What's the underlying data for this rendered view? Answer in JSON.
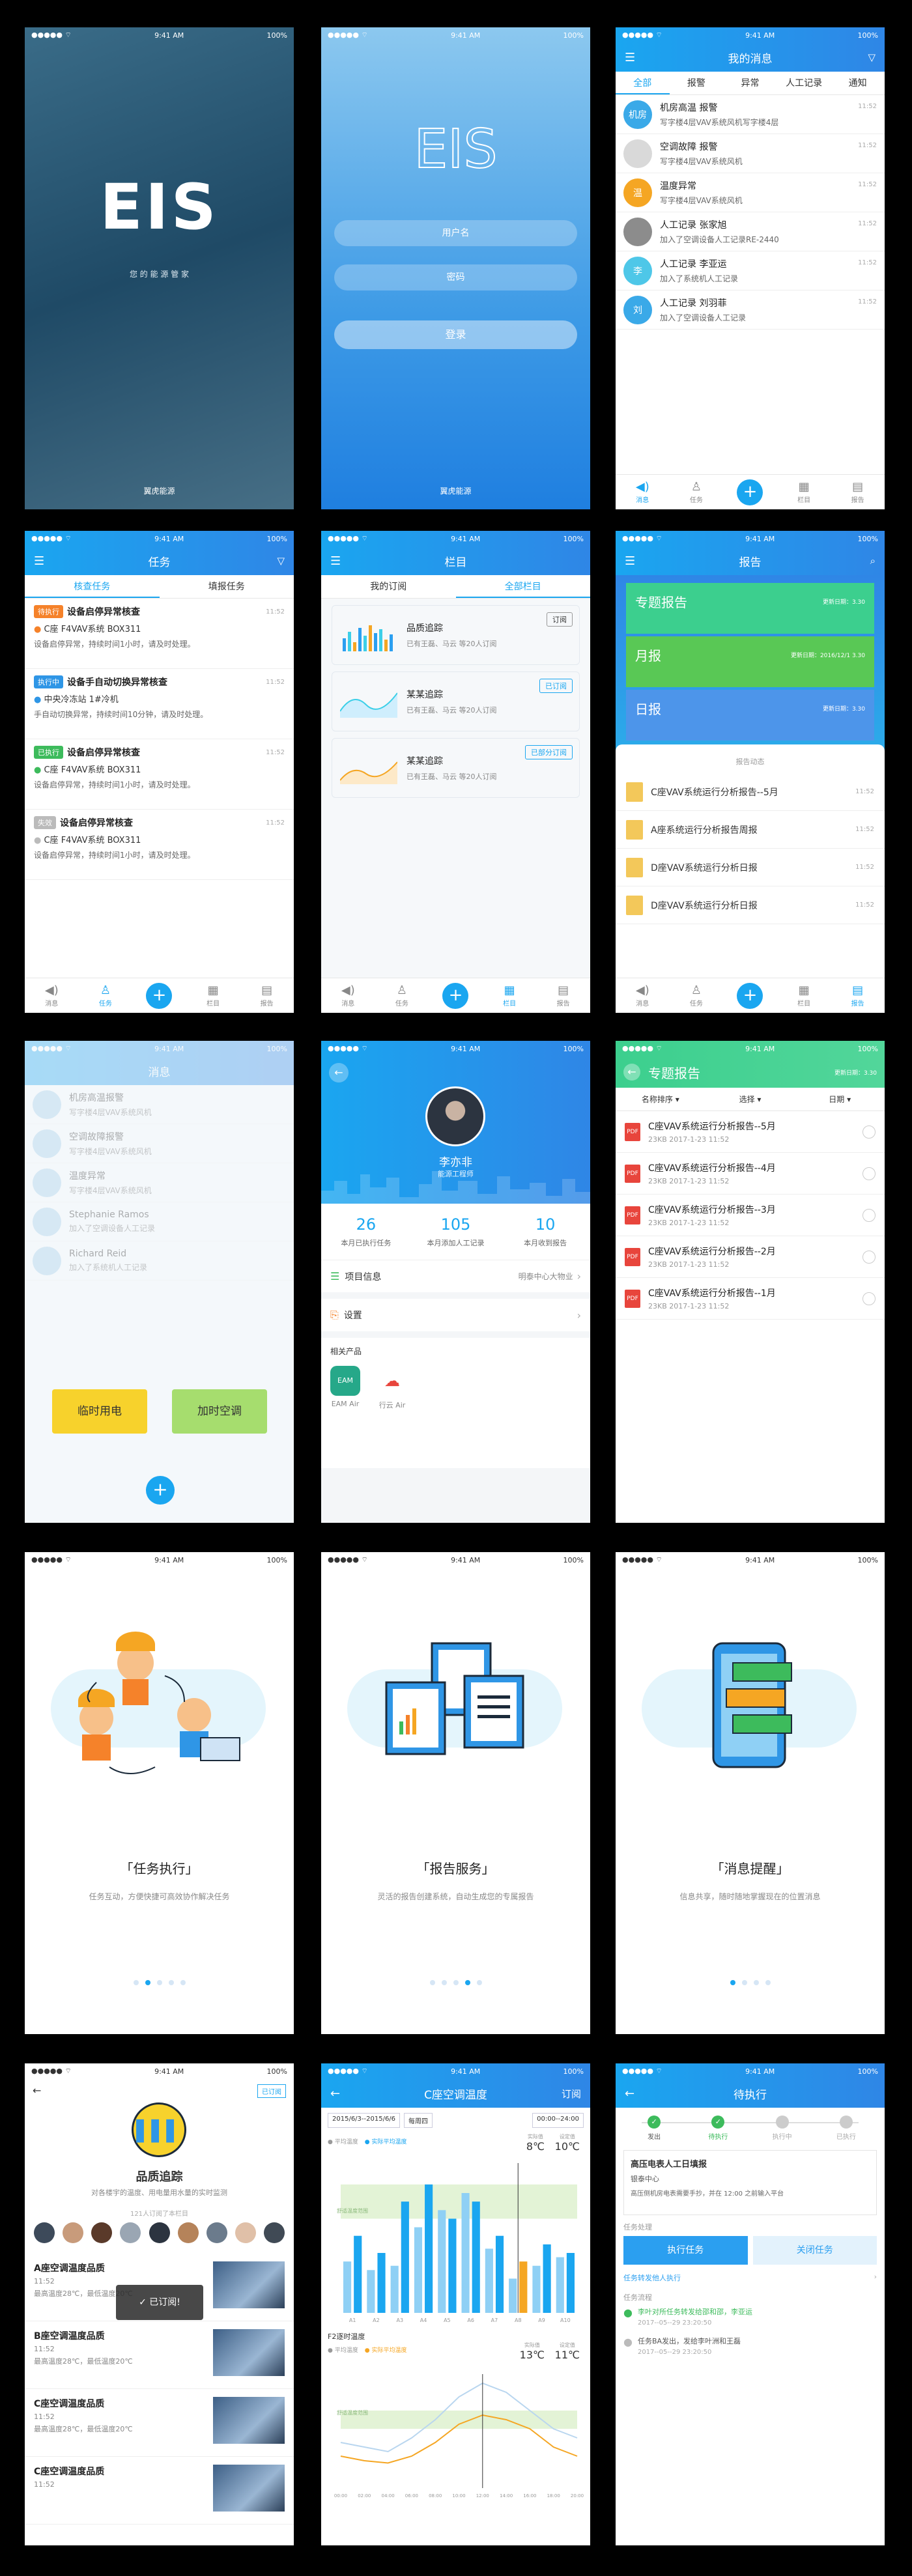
{
  "status": {
    "carrier": "●●●●● ⌔",
    "time": "9:41 AM",
    "battery": "100%"
  },
  "login": {
    "logo": "EIS",
    "slogan": "您 的 能 源 管 家",
    "footer": "翼虎能源",
    "user_ph": "用户名",
    "pass_ph": "密码",
    "button": "登录"
  },
  "messages": {
    "title": "我的消息",
    "tabs": [
      "全部",
      "报警",
      "异常",
      "人工记录",
      "通知"
    ],
    "items": [
      {
        "avatar": "机房",
        "color": "#3aa9e8",
        "title": "机房高温 报警",
        "sub": "写字楼4层VAV系统风机写字楼4层",
        "time": "11:52"
      },
      {
        "avatar": "",
        "color": "#d9d9d9",
        "title": "空调故障 报警",
        "sub": "写字楼4层VAV系统风机",
        "time": "11:52"
      },
      {
        "avatar": "温",
        "color": "#f5a623",
        "title": "温度异常",
        "sub": "写字楼4层VAV系统风机",
        "time": "11:52"
      },
      {
        "avatar": "",
        "color": "#8c8c8c",
        "title": "人工记录 张家旭",
        "sub": "加入了空调设备人工记录RE-2440",
        "time": "11:52"
      },
      {
        "avatar": "李",
        "color": "#4ec7e8",
        "title": "人工记录 李亚运",
        "sub": "加入了系统机人工记录",
        "time": "11:52"
      },
      {
        "avatar": "刘",
        "color": "#3aa9e8",
        "title": "人工记录 刘羽菲",
        "sub": "加入了空调设备人工记录",
        "time": "11:52"
      }
    ]
  },
  "tabbar": [
    "消息",
    "任务",
    "",
    "栏目",
    "报告"
  ],
  "tasks": {
    "title": "任务",
    "tabs": [
      "核查任务",
      "填报任务"
    ],
    "items": [
      {
        "tag": "待执行",
        "color": "#f5822a",
        "title": "设备启停异常核查",
        "loc": "C座 F4VAV系统 BOX311",
        "desc": "设备启停异常，持续时间1小时，请及时处理。",
        "time": "11:52"
      },
      {
        "tag": "执行中",
        "color": "#2f96e6",
        "title": "设备手自动切换异常核查",
        "loc": "中央冷冻站 1#冷机",
        "desc": "手自动切换异常，持续时间10分钟，请及时处理。",
        "time": "11:52"
      },
      {
        "tag": "已执行",
        "color": "#3dbb5c",
        "title": "设备启停异常核查",
        "loc": "C座 F4VAV系统 BOX311",
        "desc": "设备启停异常，持续时间1小时，请及时处理。",
        "time": "11:52"
      },
      {
        "tag": "失效",
        "color": "#bbbbbb",
        "title": "设备启停异常核查",
        "loc": "C座 F4VAV系统 BOX311",
        "desc": "设备启停异常，持续时间1小时，请及时处理。",
        "time": "11:52"
      }
    ]
  },
  "columns": {
    "title": "栏目",
    "tabs": [
      "我的订阅",
      "全部栏目"
    ],
    "items": [
      {
        "title": "品质追踪",
        "sub": "已有王磊、马云 等20人订阅",
        "btn": "订阅"
      },
      {
        "title": "某某追踪",
        "sub": "已有王磊、马云 等20人订阅",
        "btn": "已订阅"
      },
      {
        "title": "某某追踪",
        "sub": "已有王磊、马云 等20人订阅",
        "btn": "已部分订阅"
      }
    ]
  },
  "reports": {
    "title": "报告",
    "bands": [
      {
        "label": "专题报告",
        "meta": "更新日期：3.30"
      },
      {
        "label": "月报",
        "meta": "更新日期：2016/12/1  3.30"
      },
      {
        "label": "日报",
        "meta": "更新日期：3.30"
      }
    ],
    "section": "报告动态",
    "items": [
      {
        "title": "C座VAV系统运行分析报告--5月",
        "time": "11:52"
      },
      {
        "title": "A座系统运行分析报告周报",
        "time": "11:52"
      },
      {
        "title": "D座VAV系统运行分析日报",
        "time": "11:52"
      },
      {
        "title": "D座VAV系统运行分析日报",
        "time": "11:52"
      }
    ]
  },
  "overlay": {
    "title": "消息",
    "btn1": "临时用电",
    "btn2": "加时空调",
    "items": [
      {
        "title": "机房高温报警",
        "sub": "写字楼4层VAV系统风机"
      },
      {
        "title": "空调故障报警",
        "sub": "写字楼4层VAV系统风机"
      },
      {
        "title": "温度异常",
        "sub": "写字楼4层VAV系统风机"
      },
      {
        "title": "Stephanie Ramos",
        "sub": "加入了空调设备人工记录"
      },
      {
        "title": "Richard Reid",
        "sub": "加入了系统机人工记录"
      }
    ]
  },
  "profile": {
    "name": "李亦非",
    "role": "能源工程师",
    "stats": [
      {
        "num": "26",
        "label": "本月已执行任务"
      },
      {
        "num": "105",
        "label": "本月添加人工记录"
      },
      {
        "num": "10",
        "label": "本月收到报告"
      }
    ],
    "project_label": "项目信息",
    "project_value": "明泰中心大物业",
    "settings": "设置",
    "related": "相关产品",
    "apps": [
      {
        "name": "EAM Air",
        "icon": "EAM"
      },
      {
        "name": "行云 Air",
        "icon": "☁"
      }
    ]
  },
  "special": {
    "title": "专题报告",
    "meta": "更新日期：3.30",
    "filters": [
      "名称排序",
      "选择",
      "日期"
    ],
    "items": [
      {
        "title": "C座VAV系统运行分析报告--5月",
        "sub": "23KB   2017-1-23 11:52"
      },
      {
        "title": "C座VAV系统运行分析报告--4月",
        "sub": "23KB   2017-1-23 11:52"
      },
      {
        "title": "C座VAV系统运行分析报告--3月",
        "sub": "23KB   2017-1-23 11:52"
      },
      {
        "title": "C座VAV系统运行分析报告--2月",
        "sub": "23KB   2017-1-23 11:52"
      },
      {
        "title": "C座VAV系统运行分析报告--1月",
        "sub": "23KB   2017-1-23 11:52"
      }
    ]
  },
  "onboard": [
    {
      "title": "「任务执行」",
      "sub": "任务互动，方便快捷可高效协作解决任务"
    },
    {
      "title": "「报告服务」",
      "sub": "灵活的报告创建系统，自动生成您的专属报告"
    },
    {
      "title": "「消息提醒」",
      "sub": "信息共享，随时随地掌握现在的位置消息"
    }
  ],
  "quality": {
    "title": "品质追踪",
    "sub": "对各楼宇的温度、用电量用水量的实时监测",
    "subscribed": "已订阅",
    "count": "121人订阅了本栏目",
    "toast": "已订阅!",
    "items": [
      {
        "title": "A座空调温度品质",
        "time": "11:52",
        "sub": "最高温度28℃，最低温度20℃"
      },
      {
        "title": "B座空调温度品质",
        "time": "11:52",
        "sub": "最高温度28℃，最低温度20℃"
      },
      {
        "title": "C座空调温度品质",
        "time": "11:52",
        "sub": "最高温度28℃，最低温度20℃"
      },
      {
        "title": "C座空调温度品质",
        "time": "11:52",
        "sub": ""
      }
    ]
  },
  "temp": {
    "title": "C座空调温度",
    "action": "订阅",
    "date": "2015/6/3--2015/6/6",
    "mode": "每周四",
    "hours": "00:00--24:00",
    "chart1": {
      "legend": [
        "平均温度",
        "实际平均温度"
      ],
      "v1": "8℃",
      "v1l": "实际值",
      "v2": "10℃",
      "v2l": "设定值",
      "band": "舒适温度范围"
    },
    "chart2": {
      "title": "F2逐时温度",
      "legend": [
        "平均温度",
        "实际平均温度"
      ],
      "v1": "13℃",
      "v1l": "实际值",
      "v2": "11℃",
      "v2l": "设定值",
      "band": "舒适温度范围"
    }
  },
  "chart_data": [
    {
      "type": "bar",
      "categories": [
        "A1",
        "A2",
        "A3",
        "A4",
        "A5",
        "A6",
        "A7",
        "A8",
        "A9",
        "A10"
      ],
      "series": [
        {
          "values": [
            12,
            10,
            11,
            20,
            24,
            28,
            15,
            8,
            11,
            13
          ]
        },
        {
          "values": [
            18,
            14,
            26,
            30,
            22,
            26,
            18,
            12,
            16,
            14
          ]
        }
      ]
    },
    {
      "type": "line",
      "x": [
        "00:00",
        "02:00",
        "04:00",
        "06:00",
        "08:00",
        "10:00",
        "12:00",
        "14:00",
        "16:00",
        "18:00",
        "20:00"
      ],
      "series": [
        {
          "values": [
            20,
            18,
            16,
            22,
            30,
            40,
            46,
            42,
            34,
            26,
            22
          ]
        },
        {
          "values": [
            14,
            12,
            11,
            14,
            20,
            28,
            32,
            30,
            26,
            18,
            14
          ]
        }
      ]
    }
  ],
  "pending": {
    "title": "待执行",
    "steps": [
      "发出",
      "待执行",
      "执行中",
      "已执行"
    ],
    "card_title": "高压电表人工日填报",
    "card_loc": "银泰中心",
    "card_desc": "高压侧机房电表需要手抄，并在 12:00 之前输入平台",
    "section": "任务处理",
    "btn_exec": "执行任务",
    "btn_close": "关闭任务",
    "forward": "任务转发他人执行",
    "flow": "任务流程",
    "flow_items": [
      {
        "t": "李叶对所任务转发给邵和邵，李亚运",
        "d": "2017--05--29  23:20:50"
      },
      {
        "t": "任务BA发出，发给李叶洲和王磊",
        "d": "2017--05--29  23:20:50"
      }
    ]
  }
}
